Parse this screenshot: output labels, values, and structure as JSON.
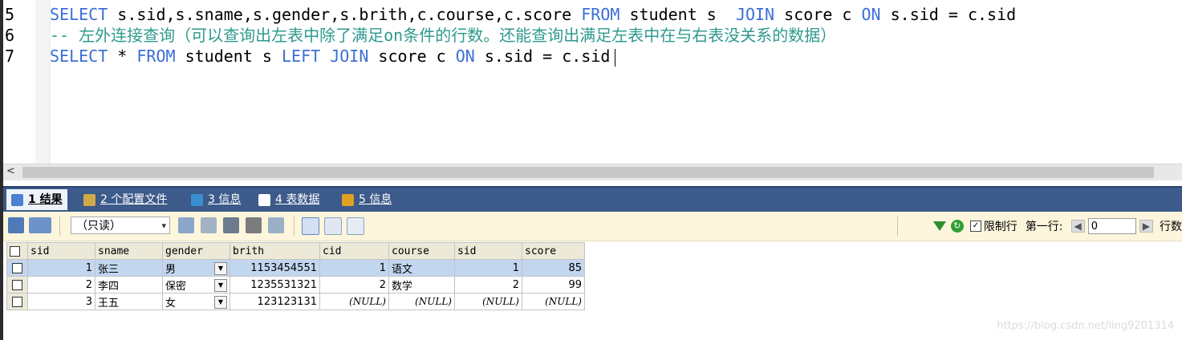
{
  "editor": {
    "lines": [
      {
        "num": "5",
        "parts": [
          {
            "t": "SELECT ",
            "c": "kw"
          },
          {
            "t": "s.sid,s.sname,s.gender,s.brith,c.course,c.score ",
            "c": "op"
          },
          {
            "t": "FROM",
            "c": "kw"
          },
          {
            "t": " student s  ",
            "c": "op"
          },
          {
            "t": "JOIN",
            "c": "kw"
          },
          {
            "t": " score c ",
            "c": "op"
          },
          {
            "t": "ON",
            "c": "kw"
          },
          {
            "t": " s.sid = c.sid",
            "c": "op"
          }
        ]
      },
      {
        "num": "6",
        "parts": [
          {
            "t": "-- 左外连接查询（可以查询出左表中除了满足on条件的行数。还能查询出满足左表中在与右表没关系的数据）",
            "c": "cm"
          }
        ]
      },
      {
        "num": "7",
        "parts": [
          {
            "t": "SELECT",
            "c": "kw"
          },
          {
            "t": " * ",
            "c": "op"
          },
          {
            "t": "FROM",
            "c": "kw"
          },
          {
            "t": " student s ",
            "c": "op"
          },
          {
            "t": "LEFT JOIN",
            "c": "kw"
          },
          {
            "t": " score c ",
            "c": "op"
          },
          {
            "t": "ON",
            "c": "kw"
          },
          {
            "t": " s.sid = c.sid",
            "c": "op"
          }
        ]
      }
    ]
  },
  "tabs": [
    {
      "label": "1 结果",
      "icon": "result-icon",
      "color": "#4a7fd1"
    },
    {
      "label": "2 个配置文件",
      "icon": "profile-icon",
      "color": "#d1a94a"
    },
    {
      "label": "3 信息",
      "icon": "info-icon",
      "color": "#3b8ed1"
    },
    {
      "label": "4 表数据",
      "icon": "table-data-icon",
      "color": "#ffffff"
    },
    {
      "label": "5 信息",
      "icon": "info2-icon",
      "color": "#e0a020"
    }
  ],
  "toolbar": {
    "mode": "（只读）",
    "limit_label": "限制行",
    "first_row_label": "第一行:",
    "first_row_value": "0",
    "rows_label": "行数"
  },
  "grid": {
    "columns": [
      "sid",
      "sname",
      "gender",
      "brith",
      "cid",
      "course",
      "sid",
      "score"
    ],
    "rows": [
      [
        "1",
        "张三",
        "男",
        "1153454551",
        "1",
        "语文",
        "1",
        "85"
      ],
      [
        "2",
        "李四",
        "保密",
        "1235531321",
        "2",
        "数学",
        "2",
        "99"
      ],
      [
        "3",
        "王五",
        "女",
        "123123131",
        "(NULL)",
        "(NULL)",
        "(NULL)",
        "(NULL)"
      ]
    ]
  },
  "watermark": "https://blog.csdn.net/ling9201314"
}
